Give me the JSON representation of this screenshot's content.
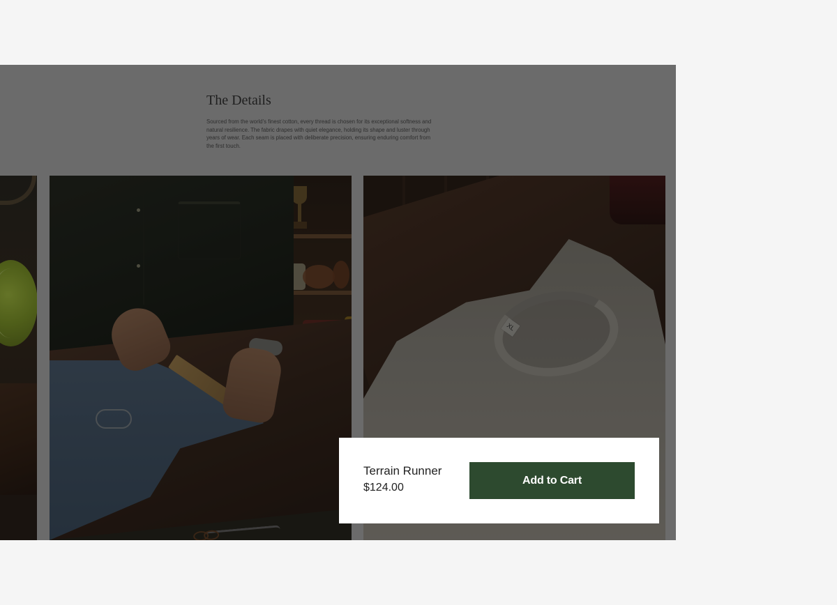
{
  "details": {
    "title": "The Details",
    "description": "Sourced from the world's finest cotton, every thread is chosen for its exceptional softness and natural resilience. The fabric drapes with quiet elegance, holding its shape and luster through years of wear. Each seam is placed with deliberate precision, ensuring enduring comfort from the first touch."
  },
  "images": {
    "right": {
      "size_tag": "XL"
    }
  },
  "product": {
    "name": "Terrain Runner",
    "price": "$124.00",
    "button_label": "Add to Cart"
  },
  "colors": {
    "page_background": "#f5f5f5",
    "overlay_panel": "#6b6b6b",
    "button_green": "#2d4a2f"
  }
}
